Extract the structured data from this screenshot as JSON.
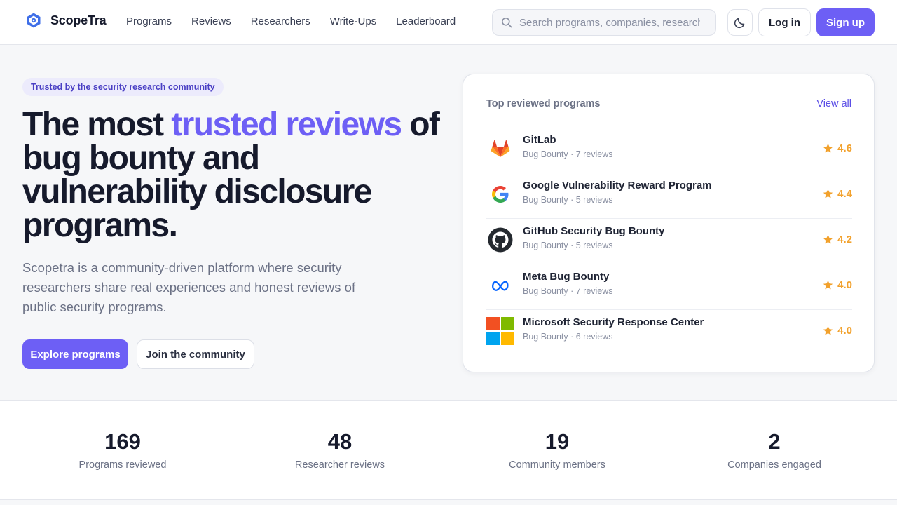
{
  "brand": {
    "name": "ScopeTra",
    "accent_color": "#6d5ff5"
  },
  "nav": {
    "items": [
      "Programs",
      "Reviews",
      "Researchers",
      "Write-Ups",
      "Leaderboard"
    ]
  },
  "search": {
    "placeholder": "Search programs, companies, researchers",
    "icon": "search-icon"
  },
  "header": {
    "theme_icon": "moon-icon",
    "login_label": "Log in",
    "signup_label": "Sign up"
  },
  "hero": {
    "badge": "Trusted by the security research community",
    "title_start": "The most ",
    "title_accent": "trusted reviews",
    "title_end": " of bug bounty and vulnerability disclosure programs.",
    "description": "Scopetra is a community-driven platform where security researchers share real experiences and honest reviews of public security programs.",
    "primary_cta": "Explore programs",
    "secondary_cta": "Join the community"
  },
  "top_programs": {
    "title": "Top reviewed programs",
    "view_all": "View all",
    "items": [
      {
        "name": "GitLab",
        "meta": "Bug Bounty · 7 reviews",
        "rating": "4.6",
        "icon": "gitlab-logo"
      },
      {
        "name": "Google Vulnerability Reward Program",
        "meta": "Bug Bounty · 5 reviews",
        "rating": "4.4",
        "icon": "google-logo"
      },
      {
        "name": "GitHub Security Bug Bounty",
        "meta": "Bug Bounty · 5 reviews",
        "rating": "4.2",
        "icon": "github-logo"
      },
      {
        "name": "Meta Bug Bounty",
        "meta": "Bug Bounty · 7 reviews",
        "rating": "4.0",
        "icon": "meta-logo"
      },
      {
        "name": "Microsoft Security Response Center",
        "meta": "Bug Bounty · 6 reviews",
        "rating": "4.0",
        "icon": "microsoft-logo"
      }
    ]
  },
  "stats": [
    {
      "value": "169",
      "label": "Programs reviewed"
    },
    {
      "value": "48",
      "label": "Researcher reviews"
    },
    {
      "value": "19",
      "label": "Community members"
    },
    {
      "value": "2",
      "label": "Companies engaged"
    }
  ]
}
